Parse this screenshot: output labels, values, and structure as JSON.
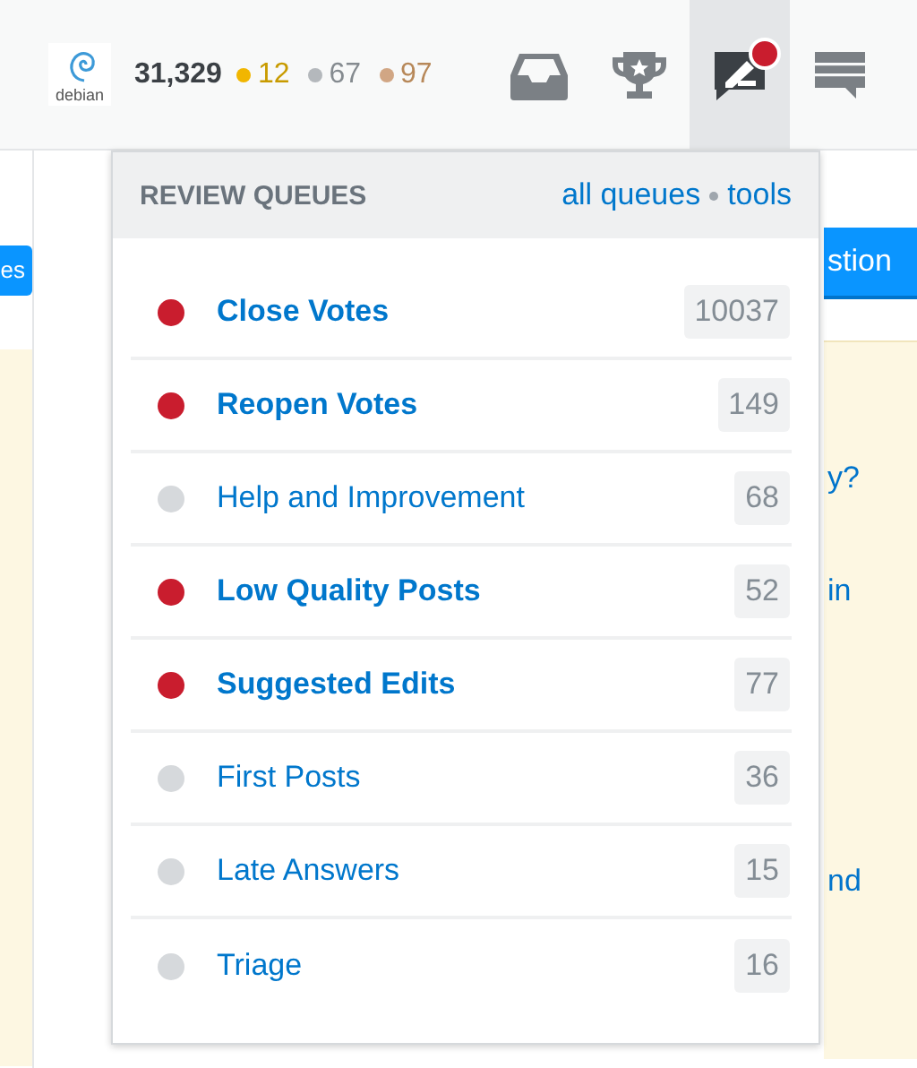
{
  "topbar": {
    "avatar_label": "debian",
    "reputation": "31,329",
    "badges": [
      {
        "kind": "gold",
        "count": "12"
      },
      {
        "kind": "silver",
        "count": "67"
      },
      {
        "kind": "bronze",
        "count": "97"
      }
    ],
    "icons": [
      {
        "kind": "inbox",
        "selected": false,
        "alert": false
      },
      {
        "kind": "trophy",
        "selected": false,
        "alert": false
      },
      {
        "kind": "review",
        "selected": true,
        "alert": true
      },
      {
        "kind": "chat",
        "selected": false,
        "alert": false
      }
    ]
  },
  "background": {
    "left_button": "es",
    "right_button": "stion",
    "right_texts": [
      "y?",
      "in",
      "nd"
    ]
  },
  "dropdown": {
    "title": "REVIEW QUEUES",
    "links": [
      "all queues",
      "tools"
    ],
    "queues": [
      {
        "name": "Close Votes",
        "count": "10037",
        "pending": true
      },
      {
        "name": "Reopen Votes",
        "count": "149",
        "pending": true
      },
      {
        "name": "Help and Improvement",
        "count": "68",
        "pending": false
      },
      {
        "name": "Low Quality Posts",
        "count": "52",
        "pending": true
      },
      {
        "name": "Suggested Edits",
        "count": "77",
        "pending": true
      },
      {
        "name": "First Posts",
        "count": "36",
        "pending": false
      },
      {
        "name": "Late Answers",
        "count": "15",
        "pending": false
      },
      {
        "name": "Triage",
        "count": "16",
        "pending": false
      }
    ]
  }
}
